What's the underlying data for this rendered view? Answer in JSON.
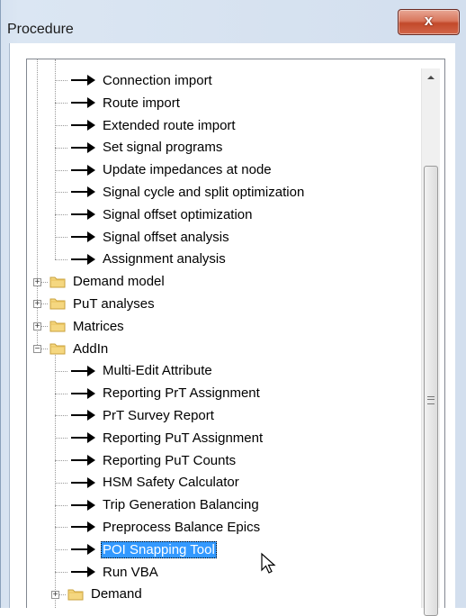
{
  "window": {
    "title": "Procedure",
    "close_glyph": "x"
  },
  "tree": {
    "procedures_before": [
      "Connection import",
      "Route import",
      "Extended route import",
      "Set signal programs",
      "Update impedances at node",
      "Signal cycle and split optimization",
      "Signal offset optimization",
      "Signal offset analysis",
      "Assignment analysis"
    ],
    "folders": [
      {
        "label": "Demand model",
        "expander": "+"
      },
      {
        "label": "PuT analyses",
        "expander": "+"
      },
      {
        "label": "Matrices",
        "expander": "+"
      },
      {
        "label": "AddIn",
        "expander": "−"
      }
    ],
    "addin_items": [
      "Multi-Edit Attribute",
      "Reporting PrT Assignment",
      "PrT Survey Report",
      "Reporting PuT Assignment",
      "Reporting PuT Counts",
      "HSM Safety Calculator",
      "Trip Generation Balancing",
      "Preprocess Balance Epics",
      "POI Snapping Tool",
      "Run VBA"
    ],
    "selected_item": "POI Snapping Tool",
    "subfolder": {
      "label": "Demand",
      "expander": "+"
    }
  }
}
